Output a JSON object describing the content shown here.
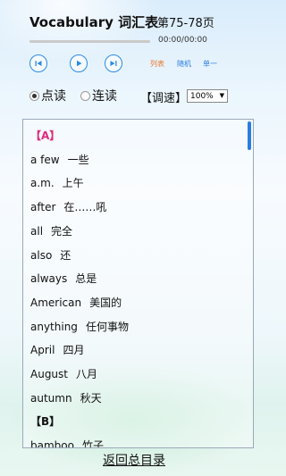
{
  "header": {
    "title": "Vocabulary 词汇表",
    "pages": "第75-78页"
  },
  "player": {
    "time": "00:00/00:00",
    "progress": 0,
    "buttons": [
      "skip-back-icon",
      "play-icon",
      "skip-forward-icon"
    ],
    "modes": [
      {
        "label": "列表",
        "color": "#e8782a"
      },
      {
        "label": "随机",
        "color": "#2a7de1"
      },
      {
        "label": "单一",
        "color": "#2a7de1"
      }
    ]
  },
  "reading": {
    "options": [
      {
        "label": "点读",
        "selected": true
      },
      {
        "label": "连读",
        "selected": false
      }
    ],
    "speed_label": "【调速】",
    "speed_value": "100%"
  },
  "vocab": {
    "section_color_active": "#e0287d",
    "section_color": "#111111",
    "sections": [
      {
        "letter": "【A】",
        "entries": [
          {
            "en": "a few",
            "cn": "一些"
          },
          {
            "en": "a.m.",
            "cn": "上午"
          },
          {
            "en": "after",
            "cn": "在……吼"
          },
          {
            "en": "all",
            "cn": "完全"
          },
          {
            "en": "also",
            "cn": "还"
          },
          {
            "en": "always",
            "cn": "总是"
          },
          {
            "en": "American",
            "cn": "美国的"
          },
          {
            "en": "anything",
            "cn": "任何事物"
          },
          {
            "en": "April",
            "cn": "四月"
          },
          {
            "en": "August",
            "cn": "八月"
          },
          {
            "en": "autumn",
            "cn": "秋天"
          }
        ]
      },
      {
        "letter": "【B】",
        "entries": [
          {
            "en": "bamboo",
            "cn": "竹子"
          }
        ]
      }
    ]
  },
  "footer": {
    "back_label": "返回总目录"
  }
}
